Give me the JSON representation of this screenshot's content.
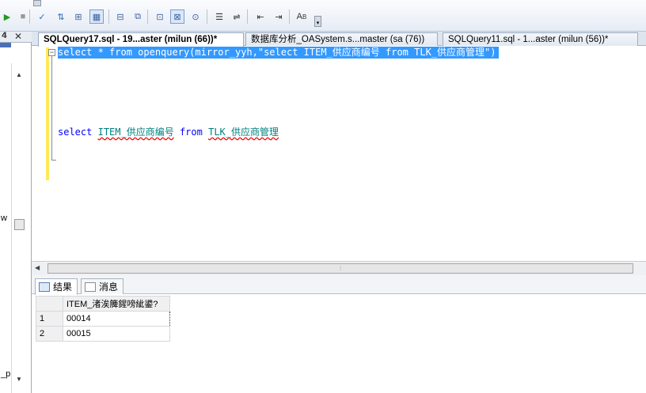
{
  "toolbar": {
    "buttons": [
      {
        "name": "execute-icon",
        "glyph": "▶"
      },
      {
        "name": "stop-icon",
        "glyph": "■"
      },
      {
        "name": "parse-check-icon",
        "glyph": "✓"
      },
      {
        "name": "query-options-icon",
        "glyph": "⇅"
      },
      {
        "name": "display-plan-icon",
        "glyph": "⊞"
      },
      {
        "name": "results-to-grid-icon",
        "glyph": "▦"
      },
      {
        "name": "design-query-icon",
        "glyph": "⊟"
      },
      {
        "name": "specify-values-icon",
        "glyph": "⧉"
      },
      {
        "name": "results-to-text-icon",
        "glyph": "⊡"
      },
      {
        "name": "results-grid-toggle-icon",
        "glyph": "⊠"
      },
      {
        "name": "results-file-icon",
        "glyph": "⊙"
      },
      {
        "name": "comment-lines-icon",
        "glyph": "☰"
      },
      {
        "name": "uncomment-lines-icon",
        "glyph": "⇌"
      },
      {
        "name": "decrease-indent-icon",
        "glyph": "⇤"
      },
      {
        "name": "increase-indent-icon",
        "glyph": "⇥"
      },
      {
        "name": "template-params-icon",
        "glyph": "A"
      }
    ],
    "template_params_sub": "B"
  },
  "left_panel": {
    "pin_glyph": "𝟰",
    "close_glyph": "✕",
    "clipped_text_1": "w",
    "clipped_text_2": "_pl"
  },
  "tabs": [
    {
      "label": "SQLQuery17.sql - 19...aster (milun (66))*",
      "active": true
    },
    {
      "label": "数据库分析_OASystem.s...master (sa (76))",
      "active": false
    },
    {
      "label": "SQLQuery11.sql - 1...aster (milun (56))*",
      "active": false
    }
  ],
  "editor": {
    "line1": "select * from openquery(mirror_yyh,\"select ITEM_供应商编号 from TLK_供应商管理\")",
    "line2": {
      "kw1": "select",
      "col": "ITEM_供应商编号",
      "kw2": "from",
      "table": "TLK_供应商管理"
    },
    "collapse_glyph": "−"
  },
  "results": {
    "tabs": [
      {
        "label": "结果",
        "active": true
      },
      {
        "label": "消息",
        "active": false
      }
    ],
    "columns": [
      "ITEM_渚涘簲鍟嗙紪鍙?"
    ],
    "rows": [
      {
        "n": "1",
        "value": "00014"
      },
      {
        "n": "2",
        "value": "00015"
      }
    ]
  },
  "colors": {
    "selection": "#3399ff",
    "keyword": "#0000ff",
    "identifier": "#008080",
    "gutter_mark": "#fde95a"
  }
}
